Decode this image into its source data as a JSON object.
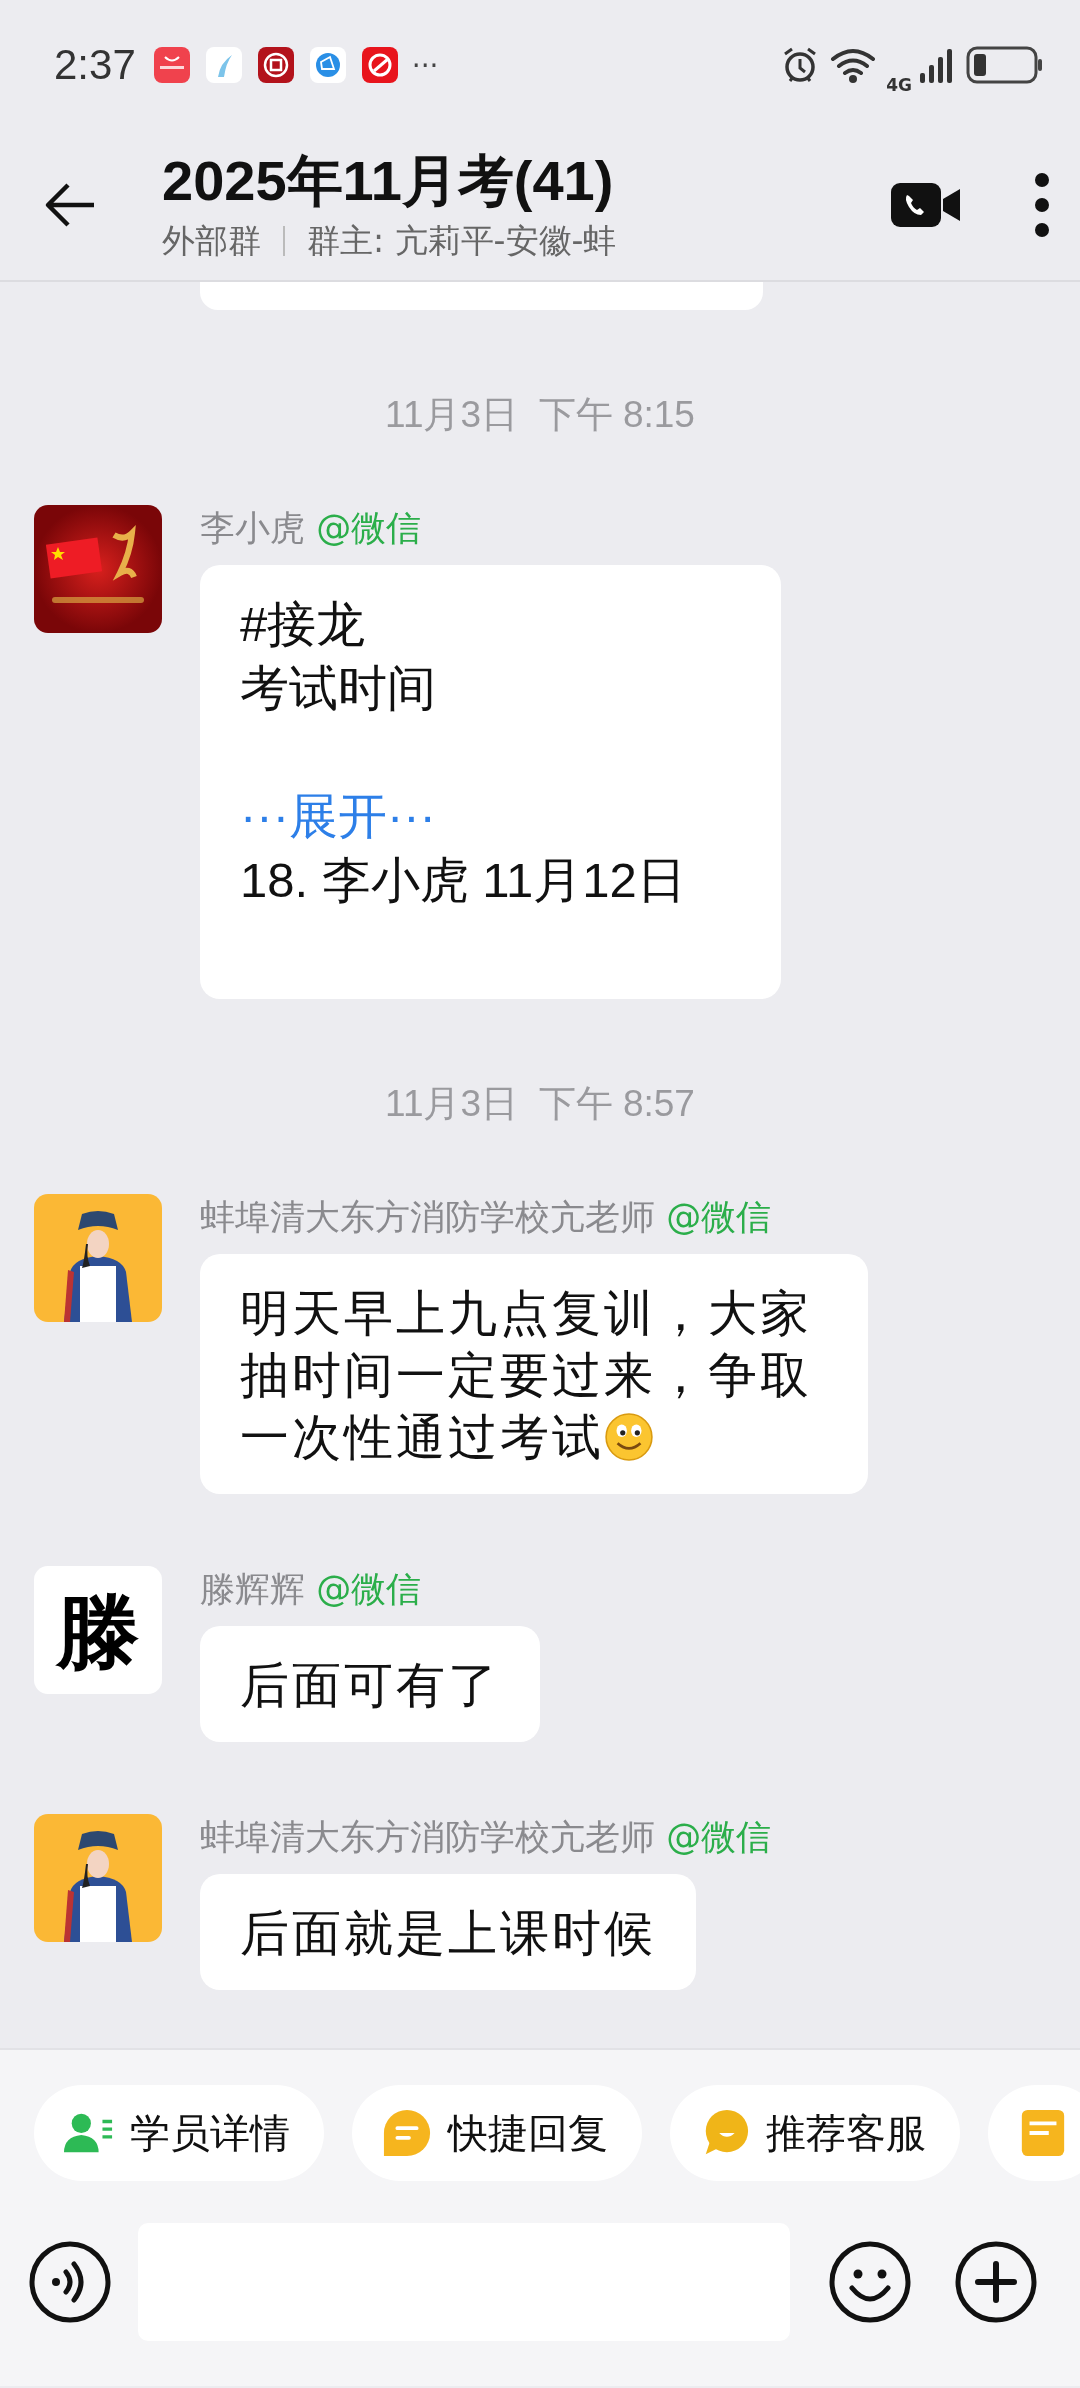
{
  "status_bar": {
    "time": "2:37",
    "more": "···",
    "network": "4G"
  },
  "header": {
    "title": "2025年11月考(41)",
    "tag": "外部群",
    "owner": "群主: 亢莉平-安徽-蚌"
  },
  "chat": [
    {
      "kind": "partial"
    },
    {
      "kind": "time",
      "text": "11月3日  下午 8:15"
    },
    {
      "kind": "message",
      "sender": "李小虎",
      "source": "@微信",
      "lines": [
        "#接龙",
        "考试时间"
      ],
      "expand": "···展开···",
      "after": [
        "18. 李小虎 11月12日"
      ]
    },
    {
      "kind": "time",
      "text": "11月3日  下午 8:57"
    },
    {
      "kind": "message",
      "sender": "蚌埠清大东方消防学校亢老师",
      "source": "@微信",
      "text": "明天早上九点复训，大家抽时间一定要过来，争取一次性通过考试",
      "emoji": true
    },
    {
      "kind": "message",
      "avatar_text": "滕",
      "sender": "滕辉辉",
      "source": "@微信",
      "text": "后面可有了"
    },
    {
      "kind": "message",
      "sender": "蚌埠清大东方消防学校亢老师",
      "source": "@微信",
      "text": "后面就是上课时候"
    }
  ],
  "shortcuts": [
    {
      "kind": "labeled",
      "label": "学员详情"
    },
    {
      "kind": "labeled",
      "label": "快捷回复"
    },
    {
      "kind": "labeled",
      "label": "推荐客服"
    },
    {
      "kind": "icon-only"
    }
  ]
}
